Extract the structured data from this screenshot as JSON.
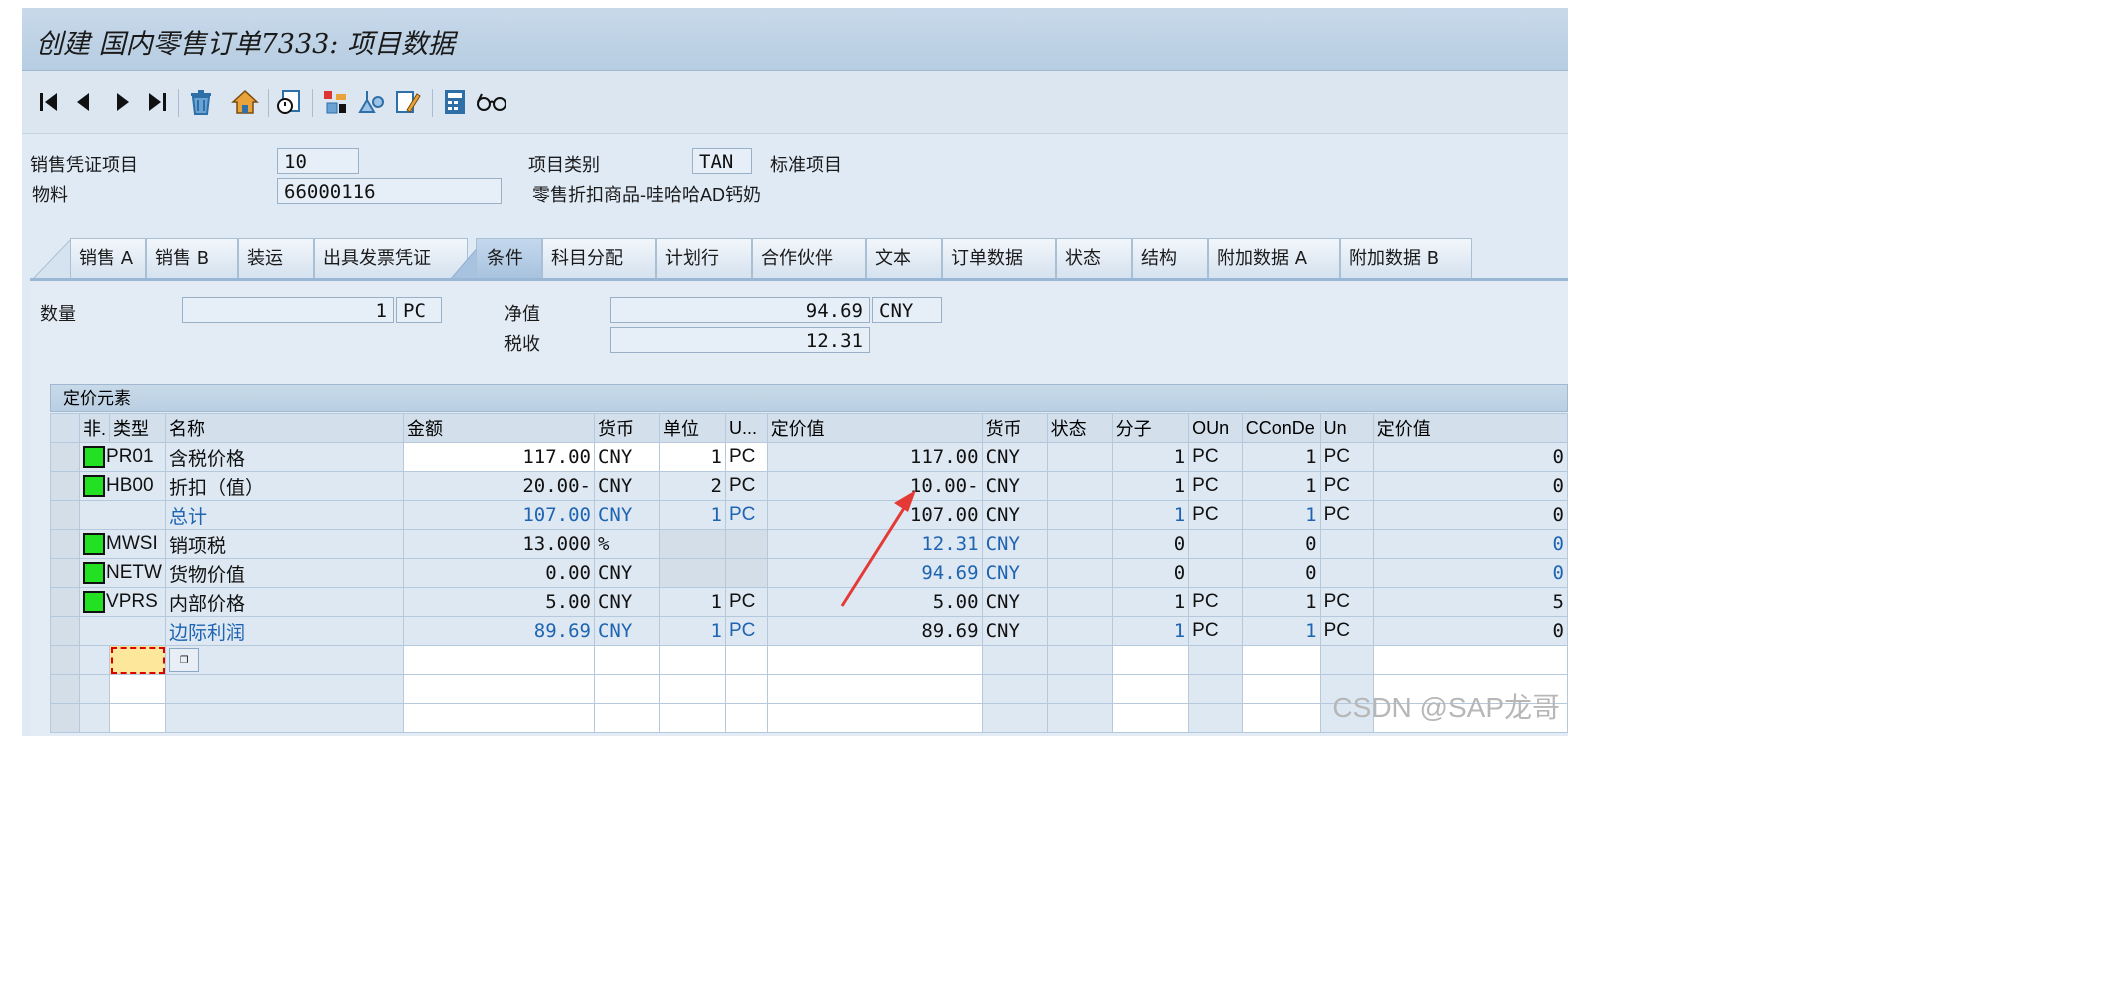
{
  "window": {
    "title": "创建 国内零售订单7333: 项目数据"
  },
  "toolbar": {
    "icons": [
      "first-page-icon",
      "previous-page-icon",
      "next-page-icon",
      "last-page-icon",
      "delete-icon",
      "home-icon",
      "document-display-icon",
      "config-icon",
      "analysis-icon",
      "edit-document-icon",
      "calculator-icon",
      "glasses-icon"
    ]
  },
  "header": {
    "item_label": "销售凭证项目",
    "item_value": "10",
    "category_label": "项目类别",
    "category_value": "TAN",
    "category_desc": "标准项目",
    "material_label": "物料",
    "material_value": "66000116",
    "material_desc": "零售折扣商品-哇哈哈AD钙奶"
  },
  "tabs": [
    {
      "label": "销售 A"
    },
    {
      "label": "销售 B"
    },
    {
      "label": "装运"
    },
    {
      "label": "出具发票凭证"
    },
    {
      "label": "条件",
      "active": true
    },
    {
      "label": "科目分配"
    },
    {
      "label": "计划行"
    },
    {
      "label": "合作伙伴"
    },
    {
      "label": "文本"
    },
    {
      "label": "订单数据"
    },
    {
      "label": "状态"
    },
    {
      "label": "结构"
    },
    {
      "label": "附加数据 A"
    },
    {
      "label": "附加数据 B"
    }
  ],
  "summary": {
    "qty_label": "数量",
    "qty_value": "1",
    "qty_unit": "PC",
    "net_label": "净值",
    "net_value": "94.69",
    "net_currency": "CNY",
    "tax_label": "税收",
    "tax_value": "12.31"
  },
  "grid": {
    "title": "定价元素",
    "columns": [
      "非.",
      "类型",
      "名称",
      "金额",
      "货币",
      "单位",
      "U...",
      "定价值",
      "货币",
      "状态",
      "分子",
      "OUn",
      "CConDe",
      "Un",
      "定价值"
    ],
    "rows": [
      {
        "type": "PR01",
        "name": "含税价格",
        "amount": "117.00",
        "cur": "CNY",
        "unit": "1",
        "u": "PC",
        "cval": "117.00",
        "ccur": "CNY",
        "num": "1",
        "oun": "PC",
        "ccon": "1",
        "un": "PC",
        "cval2": "0"
      },
      {
        "type": "HB00",
        "name": "折扣（值）",
        "amount": "20.00-",
        "cur": "CNY",
        "unit": "2",
        "u": "PC",
        "cval": "10.00-",
        "ccur": "CNY",
        "num": "1",
        "oun": "PC",
        "ccon": "1",
        "un": "PC",
        "cval2": "0"
      },
      {
        "type": "",
        "name": "总计",
        "amount": "107.00",
        "cur": "CNY",
        "unit": "1",
        "u": "PC",
        "cval": "107.00",
        "ccur": "CNY",
        "num": "1",
        "oun": "PC",
        "ccon": "1",
        "un": "PC",
        "cval2": "0"
      },
      {
        "type": "MWSI",
        "name": "销项税",
        "amount": "13.000",
        "cur": "%",
        "unit": "",
        "u": "",
        "cval": "12.31",
        "ccur": "CNY",
        "num": "0",
        "oun": "",
        "ccon": "0",
        "un": "",
        "cval2": "0"
      },
      {
        "type": "NETW",
        "name": "货物价值",
        "amount": "0.00",
        "cur": "CNY",
        "unit": "",
        "u": "",
        "cval": "94.69",
        "ccur": "CNY",
        "num": "0",
        "oun": "",
        "ccon": "0",
        "un": "",
        "cval2": "0"
      },
      {
        "type": "VPRS",
        "name": "内部价格",
        "amount": "5.00",
        "cur": "CNY",
        "unit": "1",
        "u": "PC",
        "cval": "5.00",
        "ccur": "CNY",
        "num": "1",
        "oun": "PC",
        "ccon": "1",
        "un": "PC",
        "cval2": "5"
      },
      {
        "type": "",
        "name": "边际利润",
        "amount": "89.69",
        "cur": "CNY",
        "unit": "1",
        "u": "PC",
        "cval": "89.69",
        "ccur": "CNY",
        "num": "1",
        "oun": "PC",
        "ccon": "1",
        "un": "PC",
        "cval2": "0"
      }
    ]
  },
  "watermark": "CSDN @SAP龙哥"
}
